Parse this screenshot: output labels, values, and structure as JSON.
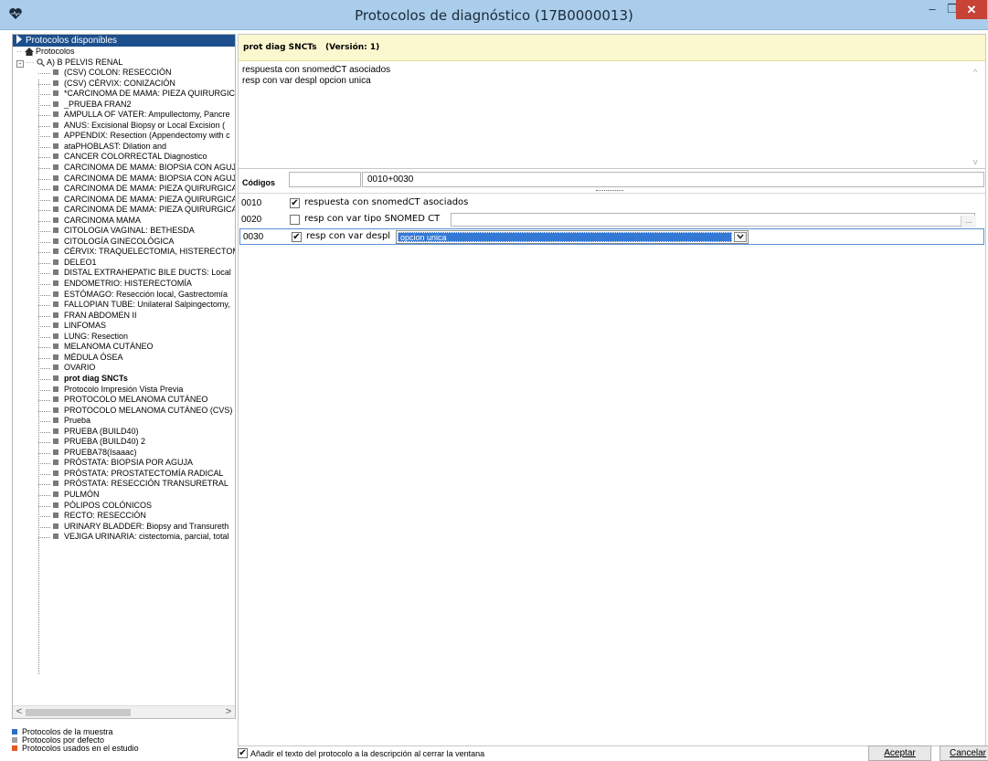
{
  "window": {
    "title": "Protocolos de diagnóstico (17B0000013)",
    "min": "–",
    "max": "❐",
    "close": "✕"
  },
  "left": {
    "header": "Protocolos disponibles",
    "root": "Protocolos",
    "group": "A) B PELVIS RENAL",
    "items": [
      "(CSV) COLON: RESECCIÓN",
      "(CSV) CÉRVIX: CONIZACIÓN",
      "*CARCINOMA DE MAMA: PIEZA QUIRURGICA",
      "_PRUEBA FRAN2",
      "AMPULLA OF VATER: Ampullectomy, Pancre",
      "ANUS: Excisional Biopsy or Local Excision (",
      "APPENDIX: Resection (Appendectomy with c",
      "ataPHOBLAST: Dilation and",
      "CANCER COLORRECTAL Diagnostico",
      "CARCINOMA DE MAMA: BIOPSIA CON AGUJ",
      "CARCINOMA DE MAMA: BIOPSIA CON AGUJ",
      "CARCINOMA DE MAMA: PIEZA QUIRURGICA",
      "CARCINOMA DE MAMA: PIEZA QUIRURGICA",
      "CARCINOMA DE MAMA: PIEZA QUIRURGICA",
      "CARCINOMA MAMA",
      "CITOLOGIA VAGINAL: BETHESDA",
      "CITOLOGÍA GINECOLÓGICA",
      "CÉRVIX: TRAQUELECTOMIA, HISTERECTOM",
      "DELEO1",
      "DISTAL EXTRAHEPATIC BILE DUCTS: Local",
      "ENDOMETRIO: HISTERECTOMÍA",
      "ESTÓMAGO: Resección local, Gastrectomía",
      "FALLOPIAN TUBE: Unilateral Salpingectomy,",
      "FRAN ABDOMEN II",
      "LINFOMAS",
      "LUNG: Resection",
      "MELANOMA CUTÁNEO",
      "MÉDULA ÓSEA",
      "OVARIO",
      "prot diag SNCTs",
      "Protocolo Impresión Vista Previa",
      "PROTOCOLO MELANOMA CUTÁNEO",
      "PROTOCOLO MELANOMA CUTÁNEO (CVS)",
      "Prueba",
      "PRUEBA (BUILD40)",
      "PRUEBA (BUILD40) 2",
      "PRUEBA78(Isaaac)",
      "PRÓSTATA: BIOPSIA POR AGUJA",
      "PRÓSTATA: PROSTATECTOMÍA RADICAL",
      "PRÓSTATA: RESECCIÓN TRANSURETRAL",
      "PULMÓN",
      "PÓLIPOS COLÓNICOS",
      "RECTO: RESECCIÓN",
      "URINARY BLADDER: Biopsy and Transureth",
      "VEJIGA URINARIA: cistectomia, parcial, total"
    ],
    "selected_item": "prot diag SNCTs",
    "scroll_left": "<",
    "scroll_right": ">"
  },
  "legend": [
    {
      "label": "Protocolos de la muestra",
      "color": "#2a6fc9"
    },
    {
      "label": "Protocolos por defecto",
      "color": "#a0a0a0"
    },
    {
      "label": "Protocolos usados en el estudio",
      "color": "#e2581e"
    }
  ],
  "protocol": {
    "title": "prot diag SNCTs   (Versión: 1)",
    "description_lines": [
      "respuesta con snomedCT asociados",
      "resp con var despl opcion unica"
    ],
    "codes_label": "Códigos",
    "codes_input": "",
    "codes_value": "0010+0030",
    "responses": [
      {
        "code": "0010",
        "checked": true,
        "check_glyph": "✔",
        "label": "respuesta con snomedCT asociados"
      },
      {
        "code": "0020",
        "checked": false,
        "check_glyph": "",
        "label": "resp con var tipo SNOMED CT",
        "button": "..."
      },
      {
        "code": "0030",
        "checked": true,
        "check_glyph": "✔",
        "label": "resp con var despl",
        "selected_option": "opcion unica"
      }
    ]
  },
  "footer": {
    "add_text_checked": true,
    "add_text_glyph": "✔",
    "add_text_label": "Añadir el texto del protocolo a la descripción al cerrar la ventana",
    "ok_label": "Aceptar",
    "cancel_label": "Cancelar"
  }
}
